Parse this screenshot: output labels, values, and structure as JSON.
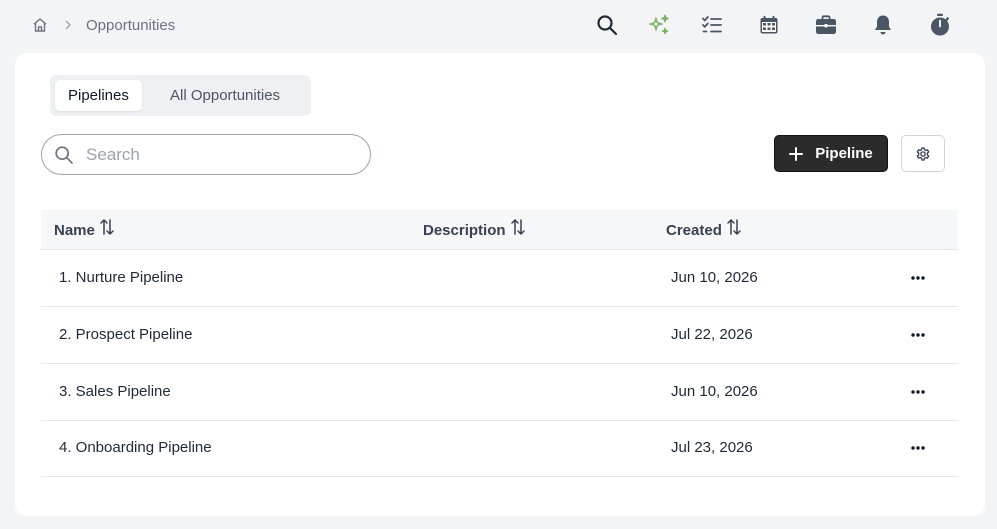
{
  "breadcrumb": {
    "home_icon": "home-icon",
    "separator_icon": "chevron-right-icon",
    "current": "Opportunities"
  },
  "toolbar_icons": [
    "search-icon",
    "sparkles-icon",
    "tasks-icon",
    "calendar-icon",
    "briefcase-icon",
    "bell-icon",
    "stopwatch-icon"
  ],
  "colors": {
    "accent_dark": "#2b2b2b",
    "sparkle": "#7fb069",
    "background": "#f3f4f6"
  },
  "tabs": [
    {
      "label": "Pipelines",
      "active": true
    },
    {
      "label": "All Opportunities",
      "active": false
    }
  ],
  "search": {
    "placeholder": "Search",
    "value": ""
  },
  "add_button": {
    "label": "Pipeline",
    "icon": "plus-icon"
  },
  "settings_button": {
    "icon": "gear-icon"
  },
  "table": {
    "columns": [
      "Name",
      "Description",
      "Created"
    ],
    "rows": [
      {
        "name": "1. Nurture Pipeline",
        "description": "",
        "created": "Jun 10, 2026"
      },
      {
        "name": "2. Prospect Pipeline",
        "description": "",
        "created": "Jul 22, 2026"
      },
      {
        "name": "3. Sales Pipeline",
        "description": "",
        "created": "Jun 10, 2026"
      },
      {
        "name": "4. Onboarding Pipeline",
        "description": "",
        "created": "Jul 23, 2026"
      }
    ]
  }
}
